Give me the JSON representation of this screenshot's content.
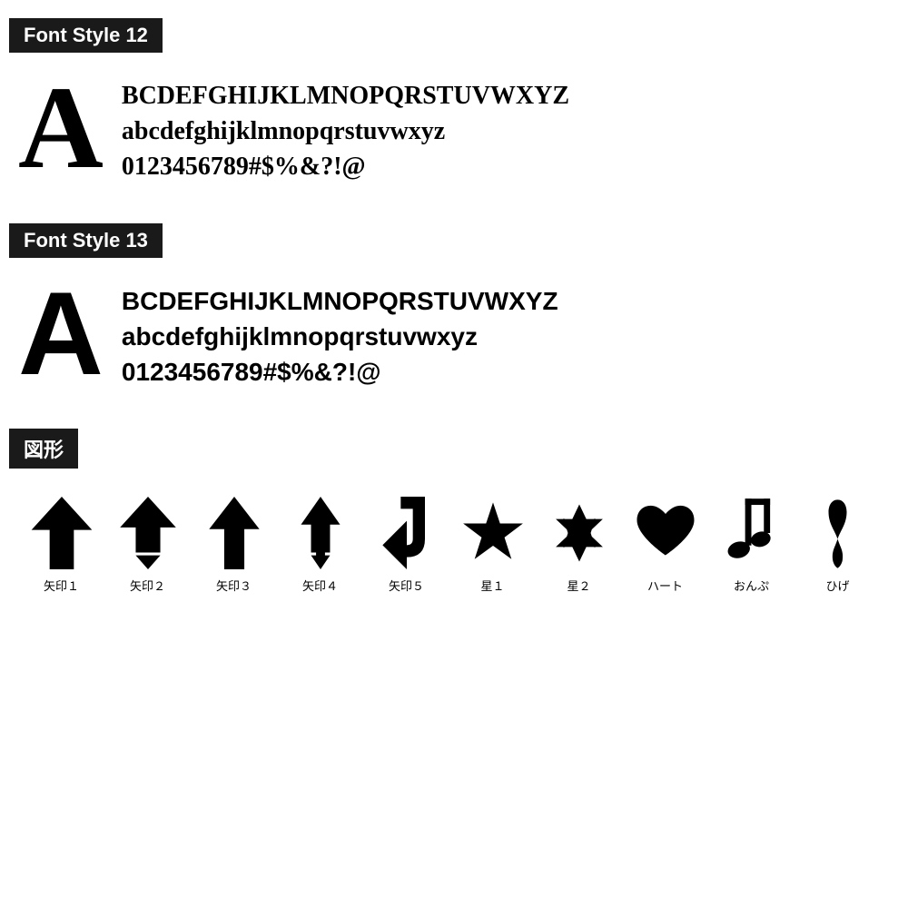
{
  "font12": {
    "label": "Font Style 12",
    "bigLetter": "A",
    "lines": [
      "BCDEFGHIJKLMNOPQRSTUVWXYZ",
      "abcdefghijklmnopqrstuvwxyz",
      "0123456789#$%&?!@"
    ]
  },
  "font13": {
    "label": "Font Style 13",
    "bigLetter": "A",
    "lines": [
      "BCDEFGHIJKLMNOPQRSTUVWXYZ",
      "abcdefghijklmnopqrstuvwxyz",
      "0123456789#$%&?!@"
    ]
  },
  "shapes": {
    "label": "図形",
    "items": [
      {
        "name": "矢印１",
        "type": "arrow1"
      },
      {
        "name": "矢印２",
        "type": "arrow2"
      },
      {
        "name": "矢印３",
        "type": "arrow3"
      },
      {
        "name": "矢印４",
        "type": "arrow4"
      },
      {
        "name": "矢印５",
        "type": "arrow5"
      },
      {
        "name": "星１",
        "type": "star1"
      },
      {
        "name": "星２",
        "type": "star2"
      },
      {
        "name": "ハート",
        "type": "heart"
      },
      {
        "name": "おんぷ",
        "type": "music"
      },
      {
        "name": "ひげ",
        "type": "mustache"
      }
    ]
  }
}
